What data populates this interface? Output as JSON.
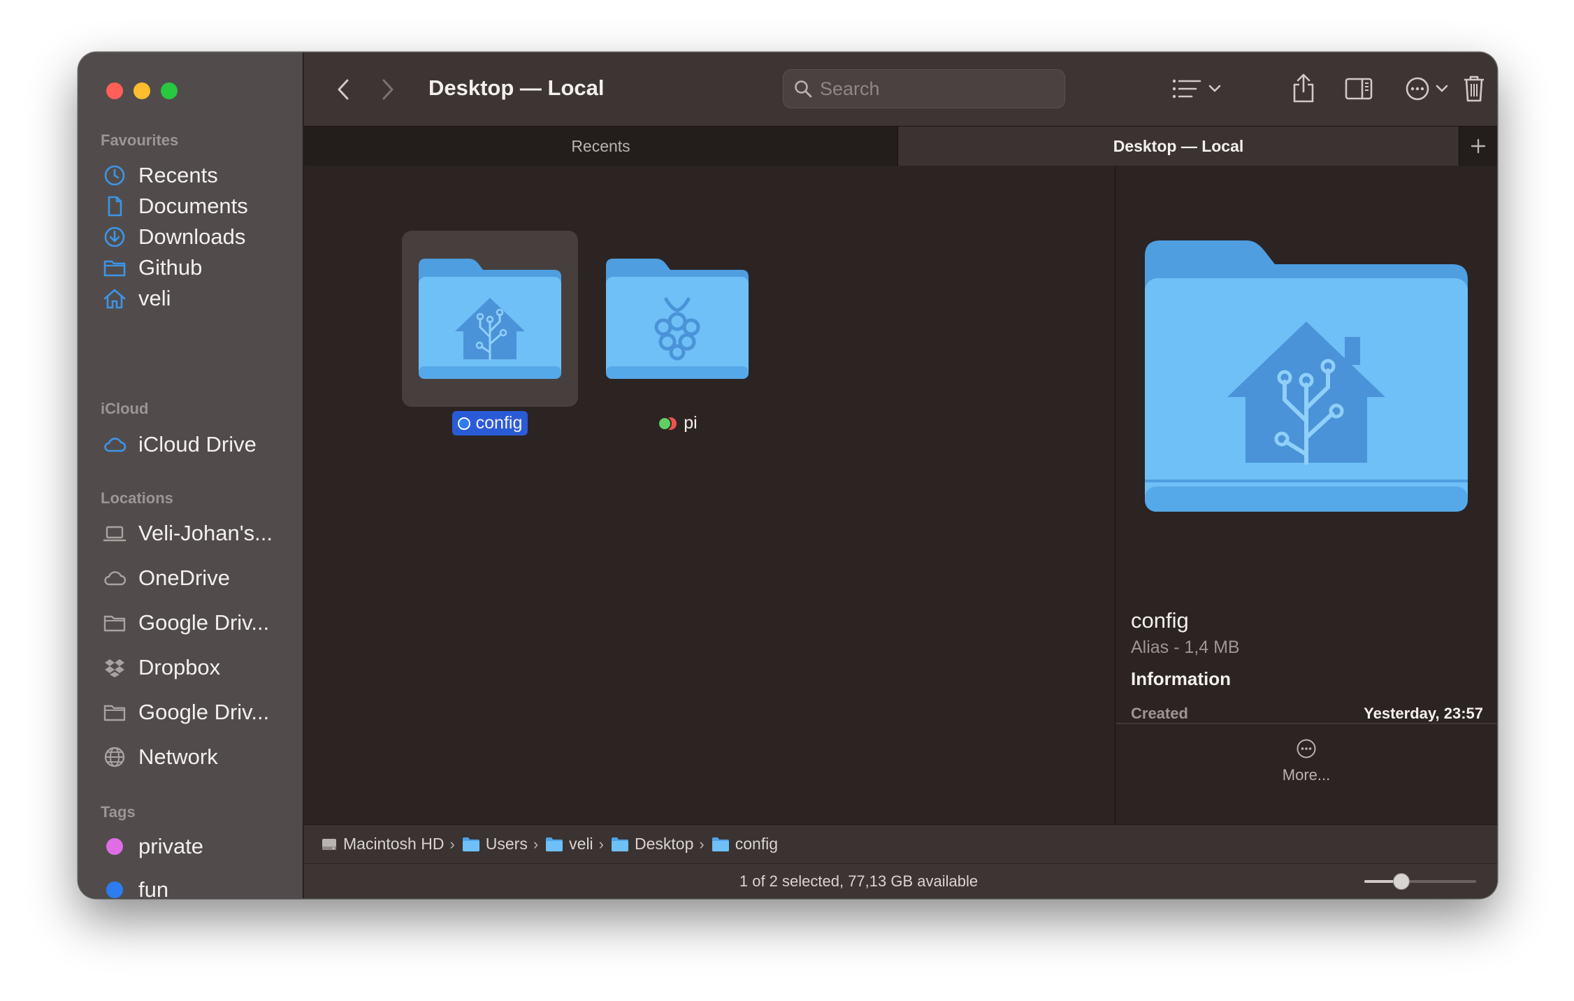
{
  "window": {
    "title": "Desktop — Local"
  },
  "toolbar": {
    "search_placeholder": "Search",
    "icons": [
      "chevron-left-icon",
      "chevron-right-icon",
      "search-icon",
      "list-view-icon",
      "chevron-down-icon",
      "share-icon",
      "sidebar-toggle-icon",
      "more-icon",
      "trash-icon"
    ]
  },
  "sidebar": {
    "favourites": {
      "title": "Favourites",
      "items": [
        {
          "label": "Recents",
          "icon": "clock-icon"
        },
        {
          "label": "Documents",
          "icon": "document-icon"
        },
        {
          "label": "Downloads",
          "icon": "download-icon"
        },
        {
          "label": "Github",
          "icon": "folder-icon"
        },
        {
          "label": "veli",
          "icon": "home-icon"
        }
      ]
    },
    "icloud": {
      "title": "iCloud",
      "items": [
        {
          "label": "iCloud Drive",
          "icon": "cloud-icon"
        }
      ]
    },
    "locations": {
      "title": "Locations",
      "items": [
        {
          "label": "Veli-Johan's...",
          "icon": "laptop-icon"
        },
        {
          "label": "OneDrive",
          "icon": "cloud-icon"
        },
        {
          "label": "Google Driv...",
          "icon": "folder-icon"
        },
        {
          "label": "Dropbox",
          "icon": "dropbox-icon"
        },
        {
          "label": "Google Driv...",
          "icon": "folder-icon"
        },
        {
          "label": "Network",
          "icon": "globe-icon"
        }
      ]
    },
    "tags": {
      "title": "Tags",
      "items": [
        {
          "label": "private",
          "color": "#de6de6"
        },
        {
          "label": "fun",
          "color": "#2d7cf0"
        }
      ]
    }
  },
  "tabs": [
    {
      "label": "Recents",
      "active": false
    },
    {
      "label": "Desktop — Local",
      "active": true
    }
  ],
  "files": [
    {
      "name": "config",
      "selected": true,
      "emblem": "home-assistant-icon",
      "tag_color": "#2d7cf0"
    },
    {
      "name": "pi",
      "selected": false,
      "emblem": "raspberry-pi-icon",
      "tag_colors": [
        "#5fcf65",
        "#f0524f"
      ]
    }
  ],
  "preview": {
    "name": "config",
    "kind": "Alias - 1,4 MB",
    "info_title": "Information",
    "created_label": "Created",
    "created_value": "Yesterday, 23:57",
    "more_label": "More..."
  },
  "pathbar": [
    {
      "label": "Macintosh HD",
      "icon": "drive-icon"
    },
    {
      "label": "Users",
      "icon": "folder-icon"
    },
    {
      "label": "veli",
      "icon": "folder-icon"
    },
    {
      "label": "Desktop",
      "icon": "folder-icon"
    },
    {
      "label": "config",
      "icon": "folder-icon"
    }
  ],
  "status": {
    "text": "1 of 2 selected, 77,13 GB available",
    "icon_size_level": 0.3
  },
  "colors": {
    "accent": "#2a5bd7",
    "sidebar_icon": "#3d95e8",
    "folder": "#63b6f0"
  }
}
